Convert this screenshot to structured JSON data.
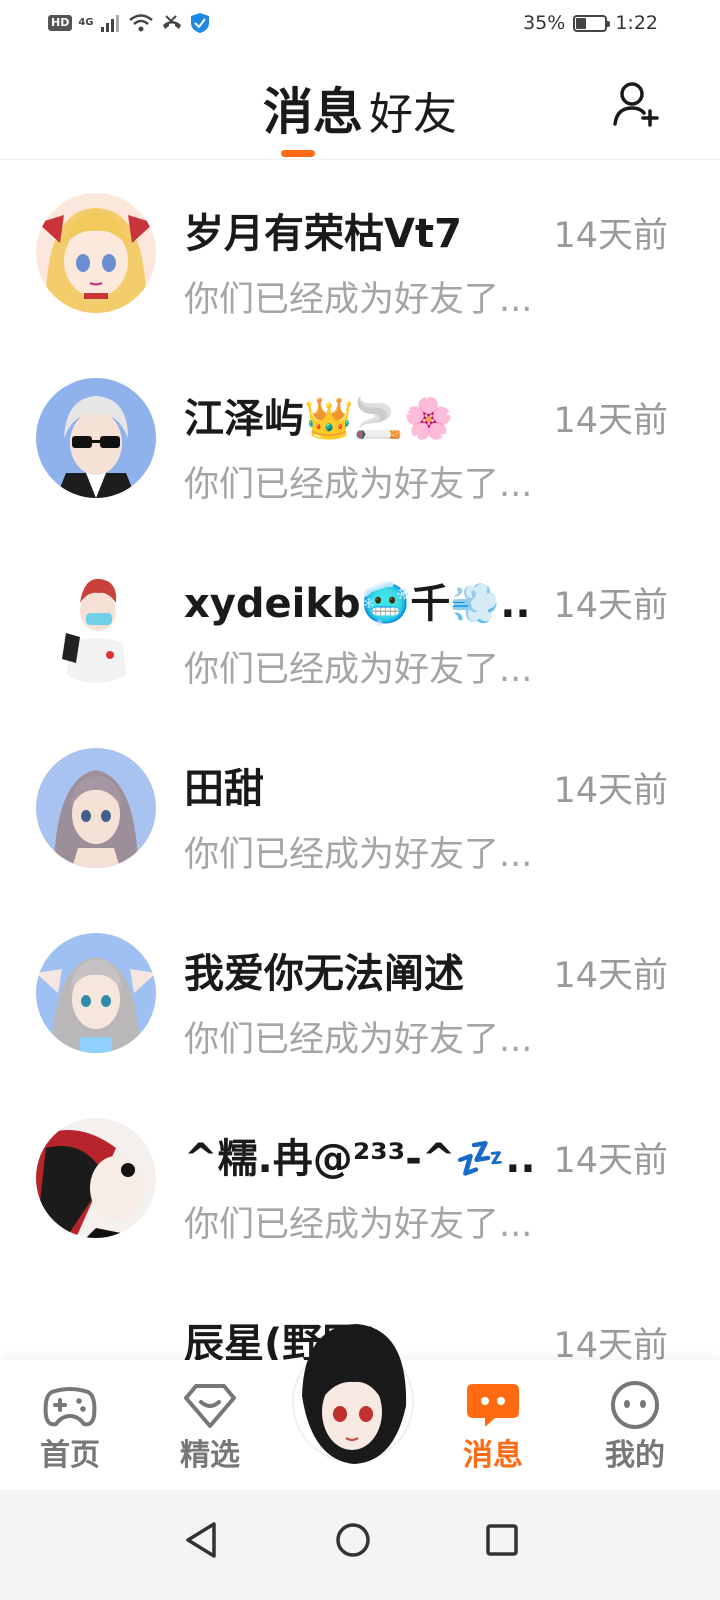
{
  "status_bar": {
    "hd": "HD",
    "network": "4G",
    "battery": "35%",
    "battery_level": 0.35,
    "time": "1:22"
  },
  "header": {
    "tabs": [
      {
        "label": "消息",
        "active": true
      },
      {
        "label": "好友",
        "active": false
      }
    ],
    "add_friend_icon": "add-person-icon",
    "accent_color": "#ff6a13"
  },
  "conversations": [
    {
      "name": "岁月有荣枯Vt7",
      "time": "14天前",
      "message": "你们已经成为好友了...",
      "avatar": "anime-girl-blonde-red-bow"
    },
    {
      "name": "江泽屿👑🚬🌸",
      "time": "14天前",
      "message": "你们已经成为好友了...",
      "avatar": "anime-boy-silver-sunglasses"
    },
    {
      "name": "xydeikb🥶千💨...",
      "time": "14天前",
      "message": "你们已经成为好友了...",
      "avatar": "anime-boy-red-hair-mask"
    },
    {
      "name": "田甜",
      "time": "14天前",
      "message": "你们已经成为好友了...",
      "avatar": "anime-girl-grey-hair"
    },
    {
      "name": "我爱你无法阐述",
      "time": "14天前",
      "message": "你们已经成为好友了...",
      "avatar": "anime-girl-silver-cat-ears"
    },
    {
      "name": "^糯.冉@²³³-^💤...",
      "time": "14天前",
      "message": "你们已经成为好友了...",
      "avatar": "anime-red-black-hair"
    },
    {
      "name": "辰星(野团)",
      "time": "14天前",
      "message": "",
      "avatar": "partial"
    }
  ],
  "bottom_nav": {
    "items": [
      {
        "label": "首页",
        "icon": "gamepad-icon",
        "active": false
      },
      {
        "label": "精选",
        "icon": "heart-icon",
        "active": false
      },
      {
        "label": "消息",
        "icon": "chat-bubble-icon",
        "active": true
      },
      {
        "label": "我的",
        "icon": "face-icon",
        "active": false
      }
    ],
    "center_icon": "profile-avatar-icon"
  },
  "system_nav": [
    "back-icon",
    "home-icon",
    "recents-icon"
  ]
}
